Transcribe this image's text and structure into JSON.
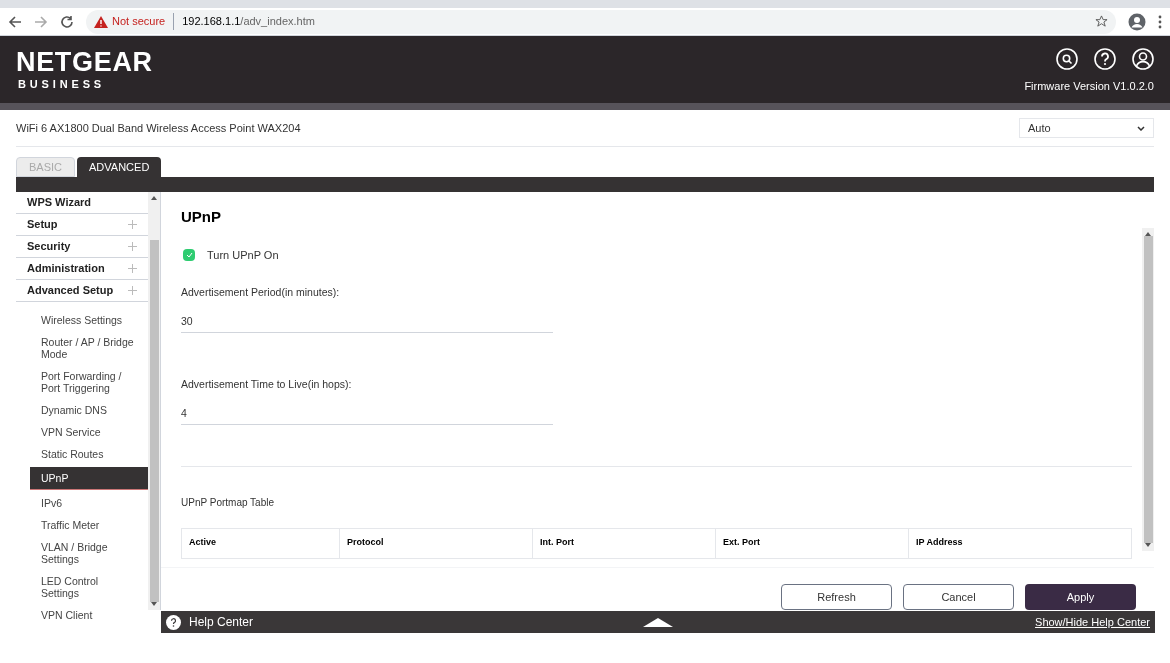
{
  "browser": {
    "security": "Not secure",
    "url_host": "192.168.1.1",
    "url_path": "/adv_index.htm"
  },
  "header": {
    "logo": "NETGEAR",
    "logo_sub": "BUSINESS",
    "firmware": "Firmware Version V1.0.2.0"
  },
  "device": {
    "title": "WiFi 6 AX1800 Dual Band Wireless Access Point WAX204",
    "language": "Auto"
  },
  "tabs": [
    {
      "label": "BASIC",
      "selected": false
    },
    {
      "label": "ADVANCED",
      "selected": true
    }
  ],
  "sidebar": {
    "items": [
      {
        "label": "WPS Wizard",
        "kind": "section",
        "expandable": false
      },
      {
        "label": "Setup",
        "kind": "section",
        "expandable": true
      },
      {
        "label": "Security",
        "kind": "section",
        "expandable": true
      },
      {
        "label": "Administration",
        "kind": "section",
        "expandable": true
      },
      {
        "label": "Advanced Setup",
        "kind": "section",
        "expandable": true
      },
      {
        "label": "Wireless Settings",
        "kind": "link",
        "selected": false
      },
      {
        "label": "Router / AP / Bridge Mode",
        "kind": "link",
        "selected": false
      },
      {
        "label": "Port Forwarding / Port Triggering",
        "kind": "link",
        "selected": false
      },
      {
        "label": "Dynamic DNS",
        "kind": "link",
        "selected": false
      },
      {
        "label": "VPN Service",
        "kind": "link",
        "selected": false
      },
      {
        "label": "Static Routes",
        "kind": "link",
        "selected": false
      },
      {
        "label": "UPnP",
        "kind": "link",
        "selected": true
      },
      {
        "label": "IPv6",
        "kind": "link",
        "selected": false
      },
      {
        "label": "Traffic Meter",
        "kind": "link",
        "selected": false
      },
      {
        "label": "VLAN / Bridge Settings",
        "kind": "link",
        "selected": false
      },
      {
        "label": "LED Control Settings",
        "kind": "link",
        "selected": false
      },
      {
        "label": "VPN Client",
        "kind": "link",
        "selected": false
      }
    ]
  },
  "main": {
    "title": "UPnP",
    "upnp_on": {
      "label": "Turn UPnP On",
      "checked": true
    },
    "fields": [
      {
        "label": "Advertisement Period(in minutes):",
        "value": "30"
      },
      {
        "label": "Advertisement Time to Live(in hops):",
        "value": "4"
      }
    ],
    "table": {
      "title": "UPnP Portmap Table",
      "columns": [
        "Active",
        "Protocol",
        "Int. Port",
        "Ext. Port",
        "IP Address"
      ]
    },
    "buttons": [
      {
        "label": "Refresh",
        "kind": "secondary"
      },
      {
        "label": "Cancel",
        "kind": "secondary"
      },
      {
        "label": "Apply",
        "kind": "primary"
      }
    ]
  },
  "help_bar": {
    "label": "Help Center",
    "link": "Show/Hide Help Center"
  }
}
